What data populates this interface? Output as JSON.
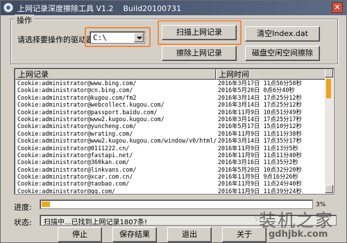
{
  "window": {
    "title": "上网记录深度擦除工具 V1.2    Build20100731",
    "close_glyph": "✕"
  },
  "operation": {
    "legend": "操作",
    "drive_label": "请选择要操作的驱动器:",
    "drive_value": "C:\\",
    "scan_label": "扫描上网记录",
    "clear_index_label": "清空Index.dat",
    "erase_label": "擦除上网记录",
    "wipe_free_label": "磁盘空闲空间擦除"
  },
  "list": {
    "col1_header": "上网记录",
    "col2_header": "上网时间",
    "rows": [
      {
        "record": "Cookie:administrator@www.bing.com/",
        "time": "2016年3月17日 11点56分58秒"
      },
      {
        "record": "Cookie:administrator@cn.bing.com/",
        "time": "2016年5月20日 0点6分40秒"
      },
      {
        "record": "Cookie:administrator@kugou.com/fm2",
        "time": "2016年3月14日 17点25分12秒"
      },
      {
        "record": "Cookie:administrator@webcollect.kugou.com/",
        "time": "2016年3月14日 17点25分12秒"
      },
      {
        "record": "Cookie:administrator@passport.baidu.com/",
        "time": "2016年11月9日 10点51分49秒"
      },
      {
        "record": "Cookie:administrator@www2.kugou.kugou.com/",
        "time": "2016年3月14日 17点25分17秒"
      },
      {
        "record": "Cookie:administrator@yuncheng.com/",
        "time": "2016年5月17日 15点10分12秒"
      },
      {
        "record": "Cookie:administrator@wrating.com/",
        "time": "2016年11月9日 11点11分38秒"
      },
      {
        "record": "Cookie:administrator@www2.kugou.kugou.com/window/v0/html/",
        "time": "2016年3月14日 17点35分17秒"
      },
      {
        "record": "Cookie:administrator@0111222.cn/",
        "time": "2016年11月9日 11点13分5秒"
      },
      {
        "record": "Cookie:administrator@fastapi.net/",
        "time": "2016年11月9日 11点11分40秒"
      },
      {
        "record": "Cookie:administrator@360kan.com/",
        "time": "2016年3月16日 11点35分2秒"
      },
      {
        "record": "Cookie:administrator@linkvans.com/",
        "time": "2016年5月20日 10点32分20秒"
      },
      {
        "record": "Cookie:administrator@xcar.com.cn/",
        "time": "2016年11月9日 9点16分26秒"
      },
      {
        "record": "Cookie:administrator@taobao.com/",
        "time": "2016年11月9日 11点24分40秒"
      },
      {
        "record": "Cookie:administrator@qq.com/",
        "time": "2016年11月9日 11点39分24秒"
      }
    ]
  },
  "progress": {
    "label": "进度:",
    "fraction": 0.03,
    "percent_text": "3%"
  },
  "status": {
    "label": "状态:",
    "text": "扫描中...已找到上网记录1807条!"
  },
  "buttons": {
    "stop": "停止",
    "save": "保存结果",
    "exit": "退出",
    "about": "关于"
  },
  "watermark": {
    "main": "装机之家",
    "url": "gdhjbk.com"
  },
  "colors": {
    "highlight": "#f08a3c",
    "progress": "#f0a81b",
    "titlebar": "#3f4b62"
  }
}
